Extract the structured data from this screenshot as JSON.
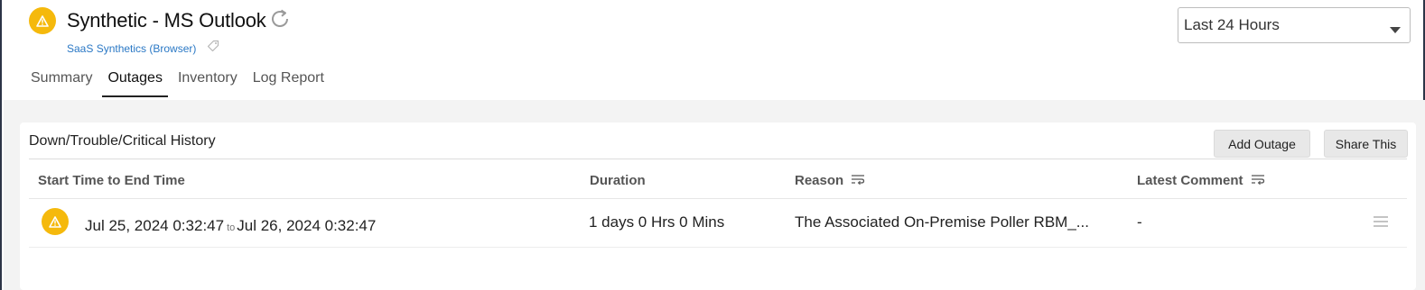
{
  "header": {
    "title": "Synthetic - MS Outlook",
    "subtitle": "SaaS Synthetics (Browser)",
    "status_color": "#f5b90c",
    "status_icon": "warning-icon"
  },
  "time_filter": {
    "selected": "Last 24 Hours"
  },
  "tabs": [
    {
      "label": "Summary",
      "active": false
    },
    {
      "label": "Outages",
      "active": true
    },
    {
      "label": "Inventory",
      "active": false
    },
    {
      "label": "Log Report",
      "active": false
    }
  ],
  "history": {
    "title": "Down/Trouble/Critical History",
    "add_button": "Add Outage",
    "share_button": "Share This",
    "columns": {
      "time": "Start Time to End Time",
      "duration": "Duration",
      "reason": "Reason",
      "comment": "Latest Comment"
    },
    "rows": [
      {
        "status_icon": "warning-icon",
        "start": "Jul 25, 2024 0:32:47",
        "to": "to",
        "end": "Jul 26, 2024 0:32:47",
        "duration": "1 days 0 Hrs 0 Mins",
        "reason": "The Associated On-Premise Poller RBM_...",
        "comment": "-"
      }
    ]
  }
}
